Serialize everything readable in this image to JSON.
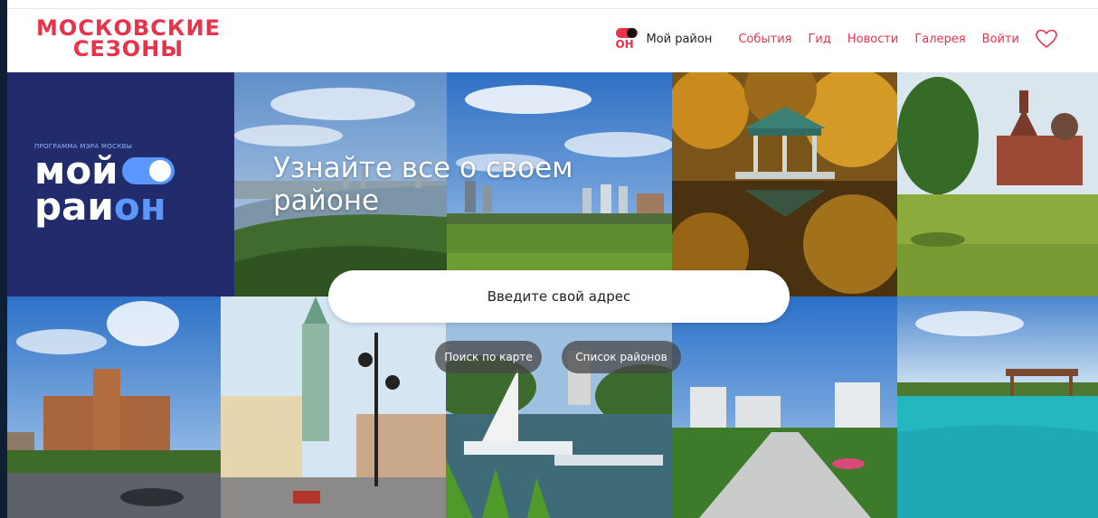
{
  "header": {
    "logo_line1": "МОСКОВСКИЕ",
    "logo_line2": "СЕЗОНЫ",
    "my_district": {
      "badge": "ОН",
      "label": "Мой район"
    },
    "nav": [
      "События",
      "Гид",
      "Новости",
      "Галерея",
      "Войти"
    ],
    "favorites_icon": "heart-icon"
  },
  "brand_tile": {
    "program": "ПРОГРАММА МЭРА МОСКВЫ",
    "line1": "мой",
    "line2_a": "раи",
    "line2_b": "он"
  },
  "hero": {
    "title": "Узнайте все о своем районе",
    "search_placeholder": "Введите свой адрес",
    "map_search_button": "Поиск по карте",
    "district_list_button": "Список районов"
  },
  "colors": {
    "brand_red": "#e8334a",
    "brand_navy": "#222b6b",
    "brand_blue": "#5a97ff"
  }
}
